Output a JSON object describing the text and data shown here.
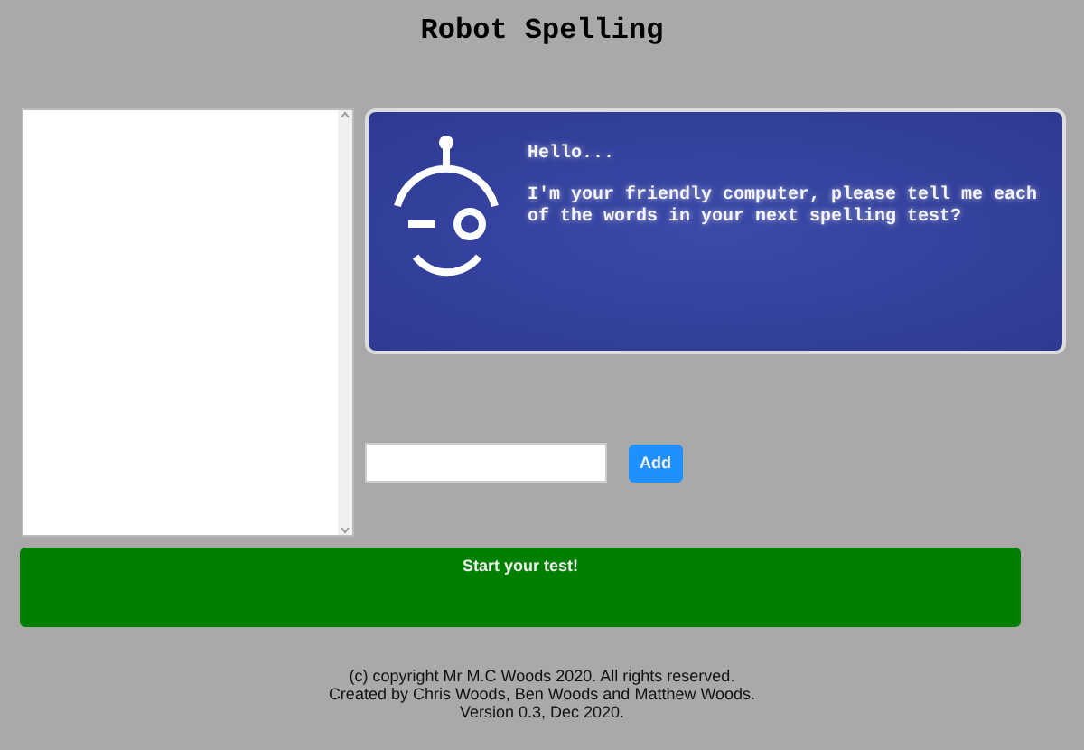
{
  "title": "Robot Spelling",
  "robot": {
    "greeting": "Hello...",
    "message": "I'm your friendly computer, please tell me each of the words in your next spelling test?"
  },
  "word_input": {
    "button": "Add"
  },
  "start_button": "Start your test!",
  "footer": [
    "(c) copyright Mr M.C Woods 2020. All rights reserved.",
    "Created by Chris Woods, Ben Woods and Matthew Woods.",
    "Version 0.3, Dec 2020."
  ]
}
